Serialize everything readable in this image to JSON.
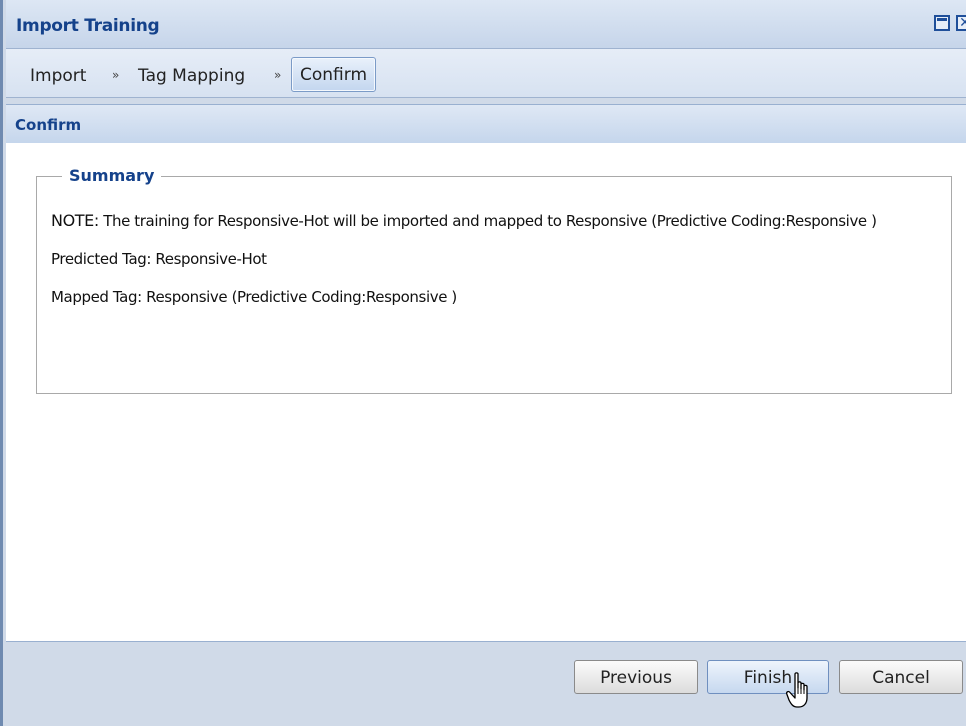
{
  "window": {
    "title": "Import Training",
    "maximize_icon": "maximize-icon",
    "close_icon": "close-icon"
  },
  "breadcrumb": {
    "steps": [
      "Import",
      "Tag Mapping",
      "Confirm"
    ],
    "separator": "»",
    "active_step": "Confirm"
  },
  "panel": {
    "title": "Confirm"
  },
  "summary": {
    "legend": "Summary",
    "note_label": "NOTE:",
    "note_text": " The training for Responsive-Hot will be imported and mapped to Responsive (Predictive Coding:Responsive )",
    "predicted_tag": "Predicted Tag: Responsive-Hot",
    "mapped_tag": "Mapped Tag: Responsive (Predictive Coding:Responsive )"
  },
  "buttons": {
    "previous": "Previous",
    "finish": "Finish",
    "cancel": "Cancel"
  },
  "colors": {
    "title_blue": "#15428b",
    "frame_blue": "#d0dae8"
  }
}
